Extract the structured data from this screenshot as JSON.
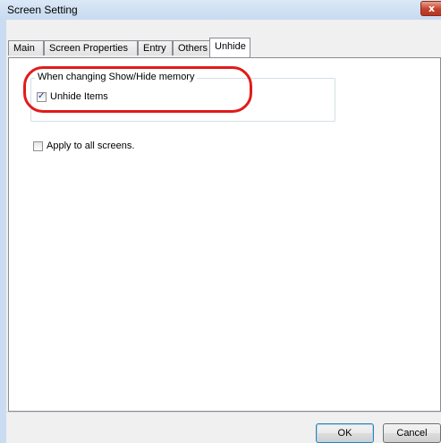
{
  "window": {
    "title": "Screen Setting",
    "close_glyph": "x"
  },
  "tabs": [
    {
      "label": "Main"
    },
    {
      "label": "Screen Properties"
    },
    {
      "label": "Entry"
    },
    {
      "label": "Others"
    },
    {
      "label": "Unhide"
    }
  ],
  "active_tab": "Unhide",
  "unhide_panel": {
    "group": {
      "legend": "When changing Show/Hide memory",
      "checkbox": {
        "label": "Unhide Items",
        "checked": true
      }
    },
    "apply_all": {
      "label": "Apply to all screens.",
      "checked": false
    },
    "highlight_color": "#e11b1b"
  },
  "buttons": {
    "ok_label": "OK",
    "cancel_label": "Cancel"
  },
  "check_glyph": "✓",
  "icons": [
    "close-icon",
    "checkmark-icon"
  ]
}
